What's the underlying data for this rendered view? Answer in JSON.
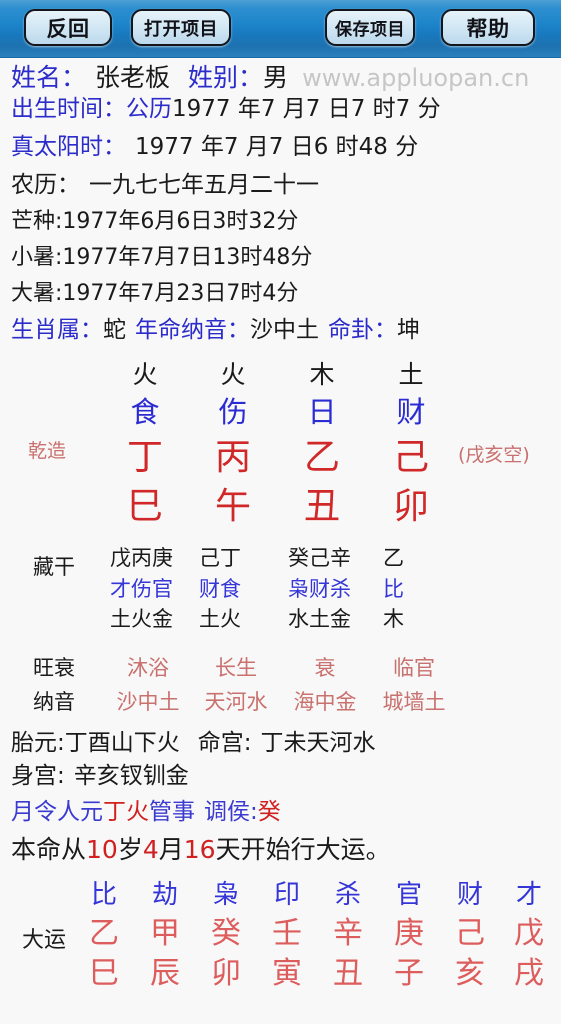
{
  "toolbar": {
    "back_label": "反回",
    "open_label": "打开项目",
    "save_label": "保存项目",
    "help_label": "帮助"
  },
  "info": {
    "name_label": "姓名：",
    "name_value": "张老板",
    "gender_label": "姓别：",
    "gender_value": "男",
    "watermark": "www.appluopan.cn",
    "birth_label": "出生时间：",
    "birth_calendar": "公历",
    "birth_value": "1977 年7 月7 日7 时7 分",
    "truesolar_label": "真太阳时：",
    "truesolar_value": "1977 年7 月7 日6 时48 分",
    "lunar_label": "农历：",
    "lunar_value": "一九七七年五月二十一",
    "term1": "芒种:1977年6月6日3时32分",
    "term2": "小暑:1977年7月7日13时48分",
    "term3": "大暑:1977年7月23日7时4分",
    "zodiac_label": "生肖属：",
    "zodiac_value": "蛇",
    "yearnayin_label": "年命纳音：",
    "yearnayin_value": "沙中土",
    "minggua_label": "命卦：",
    "minggua_value": "坤"
  },
  "pillars": {
    "side_label": "乾造",
    "void_note": "(戌亥空)",
    "columns": [
      {
        "element": "火",
        "god": "食",
        "stem": "丁",
        "branch": "巳"
      },
      {
        "element": "火",
        "god": "伤",
        "stem": "丙",
        "branch": "午"
      },
      {
        "element": "木",
        "god": "日",
        "stem": "乙",
        "branch": "丑"
      },
      {
        "element": "土",
        "god": "财",
        "stem": "己",
        "branch": "卯"
      }
    ]
  },
  "hidden_stems": {
    "label": "藏干",
    "columns": [
      {
        "stems": "戊丙庚",
        "gods": "才伤官",
        "elements": "土火金"
      },
      {
        "stems": "己丁",
        "gods": "财食",
        "elements": "土火"
      },
      {
        "stems": "癸己辛",
        "gods": "枭财杀",
        "elements": "水土金"
      },
      {
        "stems": "乙",
        "gods": "比",
        "elements": "木"
      }
    ]
  },
  "strength_nayin": {
    "strength_label": "旺衰",
    "nayin_label": "纳音",
    "strength_values": [
      "沐浴",
      "长生",
      "衰",
      "临官"
    ],
    "nayin_values": [
      "沙中土",
      "天河水",
      "海中金",
      "城墙土"
    ]
  },
  "palaces": {
    "taiyuan_label": "胎元:",
    "taiyuan_value": "丁酉山下火",
    "minggong_label": "命宫:",
    "minggong_value": "丁未天河水",
    "shengong_label": "身宫:",
    "shengong_value": "辛亥钗钏金",
    "yueling_part1": "月令人元",
    "yueling_highlight": "丁火",
    "yueling_part2": "管事",
    "tiaohou_label": "调侯:",
    "tiaohou_value": "癸",
    "dayun_start_p1": "本命从",
    "dayun_start_years": "10",
    "dayun_start_p2": "岁",
    "dayun_start_months": "4",
    "dayun_start_p3": "月",
    "dayun_start_days": "16",
    "dayun_start_p4": "天开始行大运。"
  },
  "dayun": {
    "label": "大运",
    "columns": [
      {
        "god": "比",
        "stem": "乙",
        "branch": "巳"
      },
      {
        "god": "劫",
        "stem": "甲",
        "branch": "辰"
      },
      {
        "god": "枭",
        "stem": "癸",
        "branch": "卯"
      },
      {
        "god": "印",
        "stem": "壬",
        "branch": "寅"
      },
      {
        "god": "杀",
        "stem": "辛",
        "branch": "丑"
      },
      {
        "god": "官",
        "stem": "庚",
        "branch": "子"
      },
      {
        "god": "财",
        "stem": "己",
        "branch": "亥"
      },
      {
        "god": "才",
        "stem": "戊",
        "branch": "戌"
      }
    ]
  },
  "colors": {
    "header_blue": "#1d85ca",
    "label_blue": "#2c2ccb",
    "stem_red": "#d02828",
    "muted_red": "#c9716e",
    "watermark_gray": "#c6c6c6"
  }
}
